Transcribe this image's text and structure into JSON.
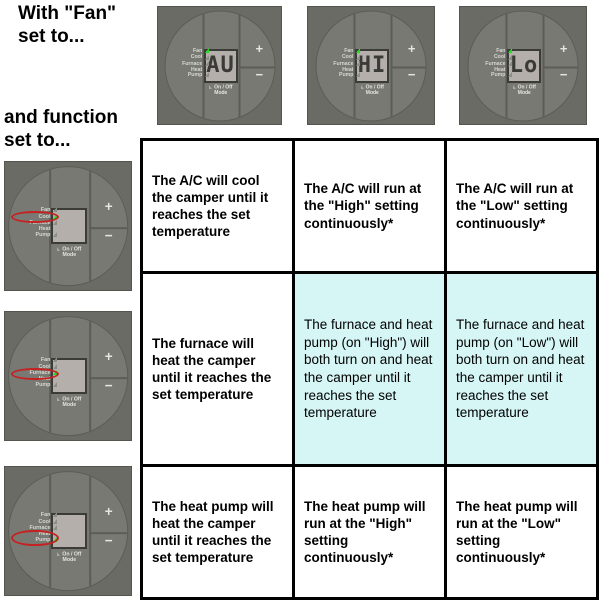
{
  "headings": {
    "fan": "With \"Fan\"\nset to...",
    "function": "and function\nset to..."
  },
  "colors": {
    "panel_body": "#6b6b66",
    "dial": "#797973",
    "lcd": "#b4afaa",
    "led_on": "#22dd22",
    "led_off": "#8d8d86",
    "marker": "#c62121",
    "highlight_cell": "#d6f5f5",
    "text": "#000000"
  },
  "panel_common": {
    "indicators": [
      "Fan",
      "Cool",
      "Furnace",
      "Heat\nPump"
    ],
    "plus_label": "+",
    "minus_label": "−",
    "onoff_label": "On / Off\nMode"
  },
  "column_panels": [
    {
      "id": "fan-auto",
      "display": "AU",
      "active_indicator": "Fan",
      "marked_indicator": null
    },
    {
      "id": "fan-high",
      "display": "HI",
      "active_indicator": "Fan",
      "marked_indicator": null
    },
    {
      "id": "fan-low",
      "display": "Lo",
      "active_indicator": "Fan",
      "marked_indicator": null
    }
  ],
  "row_panels": [
    {
      "id": "func-cool",
      "display": "",
      "active_indicator": "Cool",
      "marked_indicator": "Cool"
    },
    {
      "id": "func-furnace",
      "display": "",
      "active_indicator": "Furnace",
      "marked_indicator": "Furnace"
    },
    {
      "id": "func-heat-pump",
      "display": "",
      "active_indicator": "Heat Pump",
      "marked_indicator": "Heat Pump"
    }
  ],
  "matrix": {
    "rows": [
      {
        "row_label": "Cool",
        "cells": [
          {
            "text": "The A/C will cool the camper until it reaches the set temperature",
            "highlighted": false
          },
          {
            "text": "The A/C will run at the \"High\" setting continuously*",
            "highlighted": false
          },
          {
            "text": "The A/C will run at the \"Low\" setting continuously*",
            "highlighted": false
          }
        ]
      },
      {
        "row_label": "Furnace",
        "cells": [
          {
            "text": "The furnace will heat the camper until it reaches the set temperature",
            "highlighted": false
          },
          {
            "text": "The furnace and heat pump (on \"High\") will both turn on and heat the camper until it reaches the set temperature",
            "highlighted": true
          },
          {
            "text": "The furnace and heat pump (on \"Low\") will both turn on and heat the camper until it reaches the set temperature",
            "highlighted": true
          }
        ]
      },
      {
        "row_label": "Heat Pump",
        "cells": [
          {
            "text": "The heat pump will heat the camper until it reaches the set temperature",
            "highlighted": false
          },
          {
            "text": "The heat pump will run at the \"High\" setting continuously*",
            "highlighted": false
          },
          {
            "text": "The heat pump will run at the \"Low\" setting continuously*",
            "highlighted": false
          }
        ]
      }
    ]
  }
}
